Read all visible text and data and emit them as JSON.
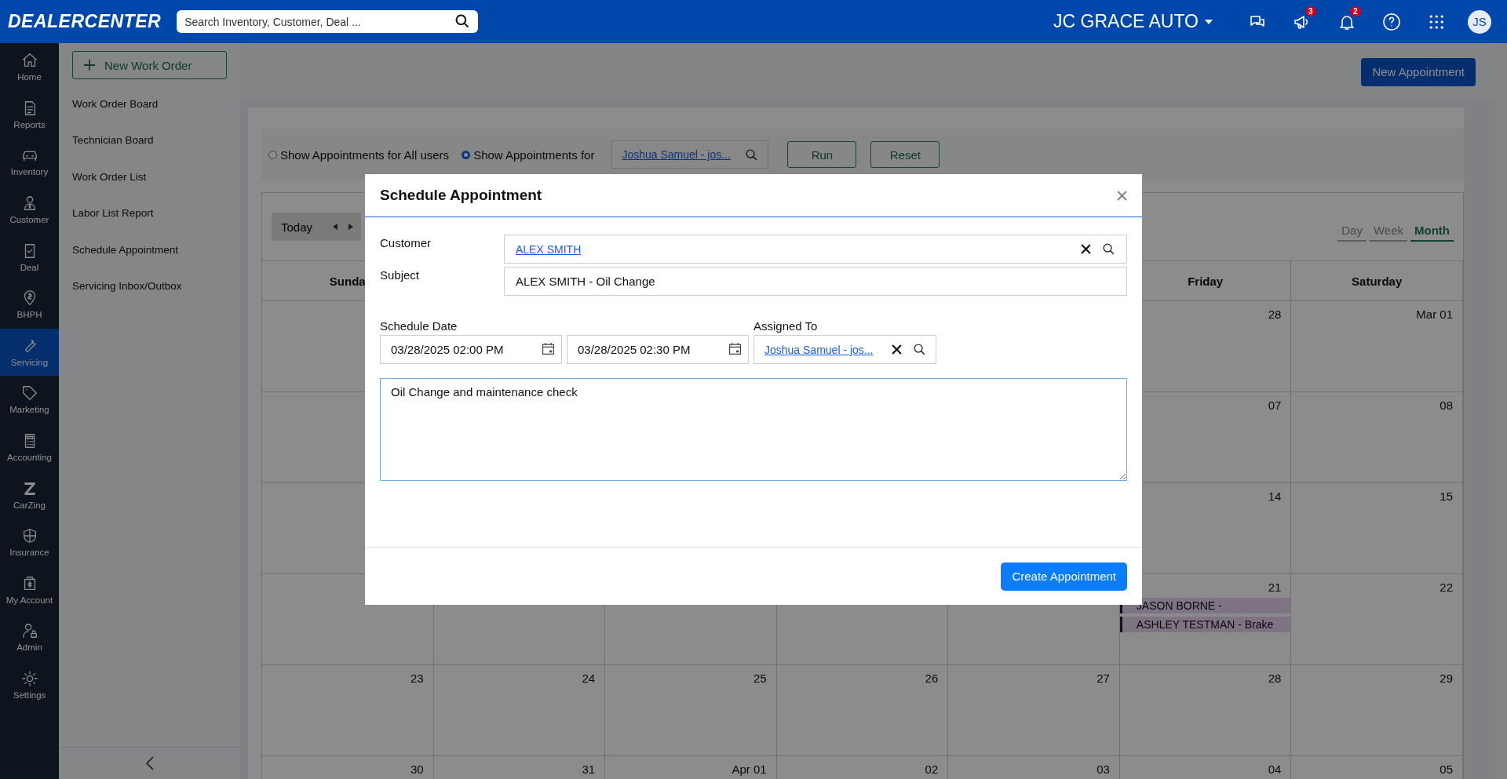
{
  "header": {
    "logo": "DEALERCENTER",
    "search": {
      "placeholder": "Search Inventory, Customer, Deal ..."
    },
    "dealer": "JC GRACE AUTO",
    "icons": [
      {
        "kind": "chat"
      },
      {
        "kind": "megaphone",
        "badge": "3"
      },
      {
        "kind": "bell",
        "badge": "2"
      },
      {
        "kind": "help"
      },
      {
        "kind": "apps"
      }
    ],
    "avatar": "JS"
  },
  "nav": [
    {
      "kind": "home",
      "label": "Home",
      "selected": false
    },
    {
      "kind": "reports",
      "label": "Reports",
      "selected": false
    },
    {
      "kind": "inventory",
      "label": "Inventory",
      "selected": false
    },
    {
      "kind": "customer",
      "label": "Customer",
      "selected": false
    },
    {
      "kind": "deal",
      "label": "Deal",
      "selected": false
    },
    {
      "kind": "bhph",
      "label": "BHPH",
      "selected": false
    },
    {
      "kind": "servicing",
      "label": "Servicing",
      "selected": true
    },
    {
      "kind": "marketing",
      "label": "Marketing",
      "selected": false
    },
    {
      "kind": "accounting",
      "label": "Accounting",
      "selected": false
    },
    {
      "kind": "carzing",
      "label": "CarZing",
      "selected": false
    },
    {
      "kind": "insurance",
      "label": "Insurance",
      "selected": false
    },
    {
      "kind": "account",
      "label": "My Account",
      "selected": false
    },
    {
      "kind": "admin",
      "label": "Admin",
      "selected": false
    },
    {
      "kind": "settings",
      "label": "Settings",
      "selected": false
    }
  ],
  "submenu": {
    "new_button": "New Work Order",
    "items": [
      "Work Order Board",
      "Technician Board",
      "Work Order List",
      "Labor List Report",
      "Schedule Appointment",
      "Servicing Inbox/Outbox"
    ]
  },
  "new_appointment": "New Appointment",
  "filter": {
    "radios": [
      {
        "label": "Show Appointments for All users",
        "selected": false
      },
      {
        "label": "Show Appointments for",
        "selected": true
      }
    ],
    "user": "Joshua Samuel - jos...",
    "buttons": [
      "Run",
      "Reset"
    ]
  },
  "calendar": {
    "today": "Today",
    "views": [
      {
        "label": "Day",
        "selected": false
      },
      {
        "label": "Week",
        "selected": false
      },
      {
        "label": "Month",
        "selected": true
      }
    ],
    "weekdays": [
      "Sunda",
      "Friday",
      "Saturday"
    ],
    "weeks": [
      {
        "days": [
          {
            "day": "28"
          },
          {
            "day": "Mar 01"
          }
        ]
      },
      {
        "days": [
          {
            "day": "07"
          },
          {
            "day": "08"
          }
        ]
      },
      {
        "days": [
          {
            "day": "14"
          },
          {
            "day": "15"
          }
        ]
      },
      {
        "days": [
          {
            "day": "21",
            "events": [
              "JASON BORNE -",
              "ASHLEY TESTMAN - Brake"
            ]
          },
          {
            "day": "22"
          }
        ]
      },
      {
        "days": [
          {
            "day": "23"
          },
          {
            "day": "24"
          },
          {
            "day": "25"
          },
          {
            "day": "26"
          },
          {
            "day": "27"
          },
          {
            "day": "28"
          },
          {
            "day": "29"
          }
        ]
      },
      {
        "days": [
          {
            "day": "30"
          },
          {
            "day": "31"
          },
          {
            "day": "Apr 01"
          },
          {
            "day": "02"
          },
          {
            "day": "03"
          },
          {
            "day": "04"
          },
          {
            "day": "05"
          }
        ]
      }
    ]
  },
  "modal": {
    "title": "Schedule Appointment",
    "customer": {
      "label": "Customer",
      "value": "ALEX SMITH"
    },
    "subject": {
      "label": "Subject",
      "value": "ALEX SMITH - Oil Change"
    },
    "schedule": {
      "label": "Schedule Date",
      "start": "03/28/2025 02:00 PM",
      "end": "03/28/2025 02:30 PM"
    },
    "assigned": {
      "label": "Assigned To",
      "value": "Joshua Samuel - jos..."
    },
    "notes": "Oil Change and maintenance check",
    "button": "Create Appointment"
  }
}
